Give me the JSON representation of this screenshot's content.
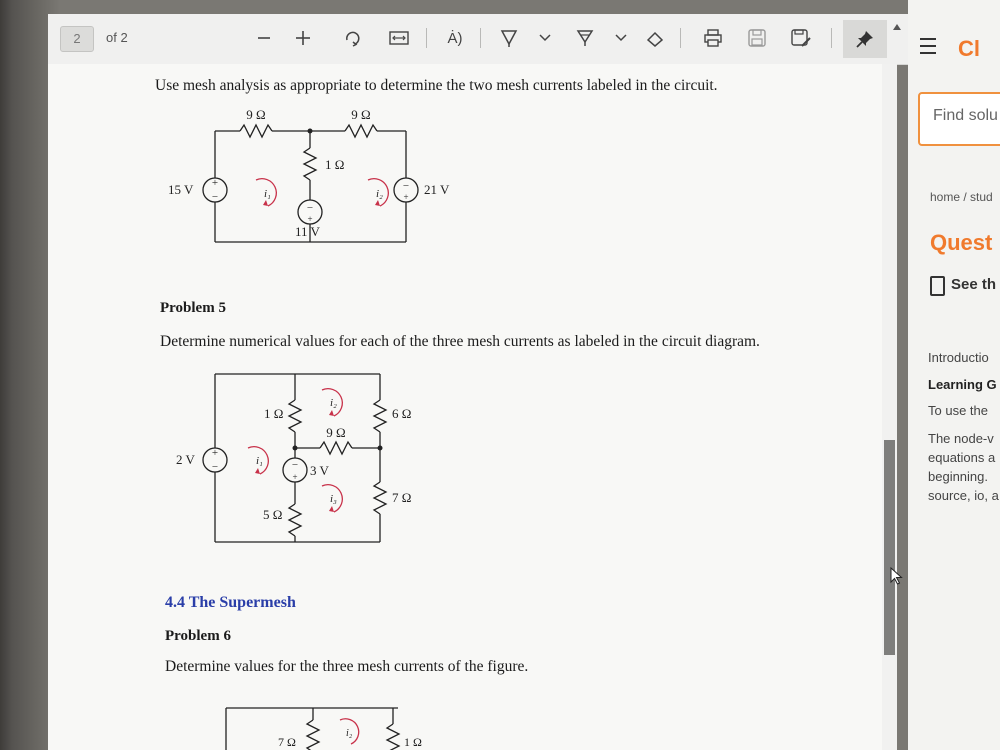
{
  "toolbar": {
    "page_number": "2",
    "page_of": "of 2",
    "read_aloud_label": "Ȧ)"
  },
  "page": {
    "intro": "Use mesh analysis as appropriate to determine the two mesh currents labeled in the circuit.",
    "problem5_title": "Problem 5",
    "problem5_text": "Determine numerical values for each of the three mesh currents as labeled in the circuit diagram.",
    "section_title": "4.4 The Supermesh",
    "problem6_title": "Problem 6",
    "problem6_text": "Determine values for the three mesh currents of the figure."
  },
  "circuit1": {
    "r_top_left": "9 Ω",
    "r_top_right": "9 Ω",
    "r_middle": "1 Ω",
    "v_left": "15 V",
    "v_right": "21 V",
    "v_middle": "11 V",
    "i1": "i₁",
    "i2": "i₂"
  },
  "circuit2": {
    "r_left": "1 Ω",
    "r_bottom_left": "5 Ω",
    "r_mid": "9 Ω",
    "r_right_top": "6 Ω",
    "r_right_bottom": "7 Ω",
    "v_left": "2 V",
    "v_mid": "3 V",
    "i1": "i₁",
    "i2": "i₂",
    "i3": "i₃"
  },
  "circuit3": {
    "r_left": "7 Ω",
    "r_right": "1 Ω",
    "i2": "i₂"
  },
  "side": {
    "brand": "Cl",
    "find_placeholder": "Find solu",
    "breadcrumb": "home / stud",
    "question": "Quest",
    "see": "See th",
    "line1": "Introductio",
    "line2": "Learning G",
    "line3": "To use the",
    "line4": "The node-v",
    "line5": "equations a",
    "line6": "beginning.",
    "line7": "source, io, a"
  },
  "colors": {
    "accent": "#f07a2d",
    "section_blue": "#2a3ea8",
    "mesh_red": "#c8324a"
  }
}
